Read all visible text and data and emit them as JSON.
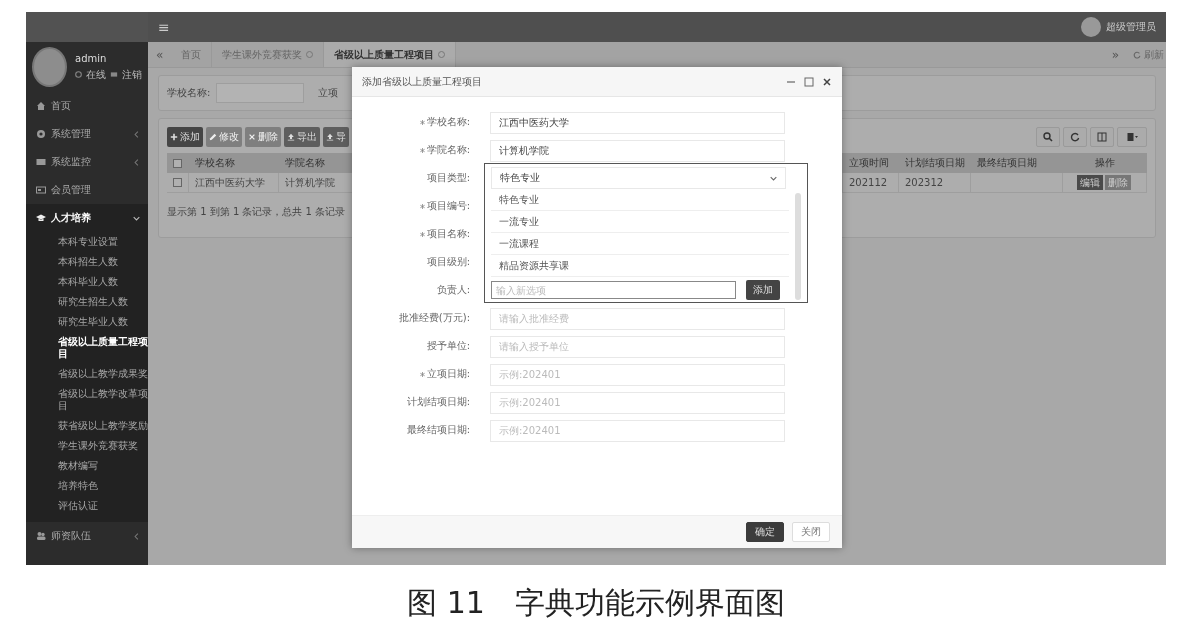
{
  "topbar": {
    "menu_glyph": "≡",
    "user": "超级管理员"
  },
  "sidebar": {
    "user": {
      "name": "admin",
      "status": "在线",
      "logout": "注销"
    },
    "items": [
      {
        "kind": "link",
        "label": "首页",
        "selected": false
      },
      {
        "kind": "group",
        "label": "系统管理",
        "expanded": false
      },
      {
        "kind": "group",
        "label": "系统监控",
        "expanded": false
      },
      {
        "kind": "link",
        "label": "会员管理",
        "selected": false
      },
      {
        "kind": "group",
        "label": "人才培养",
        "expanded": true,
        "children": [
          {
            "label": "本科专业设置",
            "selected": false
          },
          {
            "label": "本科招生人数",
            "selected": false
          },
          {
            "label": "本科毕业人数",
            "selected": false
          },
          {
            "label": "研究生招生人数",
            "selected": false
          },
          {
            "label": "研究生毕业人数",
            "selected": false
          },
          {
            "label": "省级以上质量工程项目",
            "selected": true
          },
          {
            "label": "省级以上教学成果奖",
            "selected": false
          },
          {
            "label": "省级以上教学改革项目",
            "selected": false
          },
          {
            "label": "获省级以上教学奖励",
            "selected": false
          },
          {
            "label": "学生课外竞赛获奖",
            "selected": false
          },
          {
            "label": "教材编写",
            "selected": false
          },
          {
            "label": "培养特色",
            "selected": false
          },
          {
            "label": "评估认证",
            "selected": false
          }
        ]
      },
      {
        "kind": "group",
        "label": "师资队伍",
        "expanded": false
      }
    ]
  },
  "tabs": [
    {
      "label": "首页",
      "closable": false,
      "selected": false
    },
    {
      "label": "学生课外竞赛获奖",
      "closable": true,
      "selected": false
    },
    {
      "label": "省级以上质量工程项目",
      "closable": true,
      "selected": true
    }
  ],
  "tab_nav": {
    "prev": "«",
    "next": "»",
    "refresh": "刷新"
  },
  "search": {
    "label": "学校名称:",
    "next_label": "立项"
  },
  "toolbar": [
    {
      "label": "添加",
      "kind": "add",
      "disabled": false
    },
    {
      "label": "修改",
      "kind": "edit",
      "disabled": true
    },
    {
      "label": "删除",
      "kind": "delete",
      "disabled": true
    },
    {
      "label": "导出",
      "kind": "export",
      "disabled": false
    },
    {
      "label": "导",
      "kind": "import",
      "disabled": false
    }
  ],
  "table": {
    "header_checked": false,
    "columns": [
      "学校名称",
      "学院名称",
      "立项时间",
      "计划结项日期",
      "最终结项日期",
      "操作"
    ],
    "rows": [
      {
        "checked": false,
        "cells": [
          "江西中医药大学",
          "计算机学院",
          "202112",
          "202312",
          ""
        ],
        "actions": [
          "编辑",
          "删除"
        ]
      }
    ],
    "footer": "显示第 1 到第 1 条记录，总共 1 条记录"
  },
  "modal": {
    "title": "添加省级以上质量工程项目",
    "fields": [
      {
        "label": "学校名称:",
        "required": true,
        "kind": "text",
        "value": "江西中医药大学"
      },
      {
        "label": "学院名称:",
        "required": true,
        "kind": "text",
        "value": "计算机学院"
      },
      {
        "label": "项目类型:",
        "required": false,
        "kind": "select",
        "value": "特色专业"
      },
      {
        "label": "项目编号:",
        "required": true,
        "kind": "hidden"
      },
      {
        "label": "项目名称:",
        "required": true,
        "kind": "hidden"
      },
      {
        "label": "项目级别:",
        "required": false,
        "kind": "hidden"
      },
      {
        "label": "负责人:",
        "required": false,
        "kind": "hidden"
      },
      {
        "label": "批准经费(万元):",
        "required": false,
        "kind": "text",
        "placeholder": "请输入批准经费"
      },
      {
        "label": "授予单位:",
        "required": false,
        "kind": "text",
        "placeholder": "请输入授予单位"
      },
      {
        "label": "立项日期:",
        "required": true,
        "kind": "text",
        "placeholder": "示例:202401"
      },
      {
        "label": "计划结项日期:",
        "required": false,
        "kind": "text",
        "placeholder": "示例:202401"
      },
      {
        "label": "最终结项日期:",
        "required": false,
        "kind": "text",
        "placeholder": "示例:202401"
      }
    ],
    "dropdown": {
      "options": [
        {
          "label": "特色专业",
          "selected": false
        },
        {
          "label": "一流专业",
          "selected": false
        },
        {
          "label": "一流课程",
          "selected": false
        },
        {
          "label": "精品资源共享课",
          "selected": false
        }
      ],
      "new_option_placeholder": "输入新选项",
      "add_button": "添加"
    },
    "buttons": [
      {
        "label": "确定",
        "kind": "primary"
      },
      {
        "label": "关闭",
        "kind": "default"
      }
    ]
  },
  "caption": "图 11　字典功能示例界面图"
}
